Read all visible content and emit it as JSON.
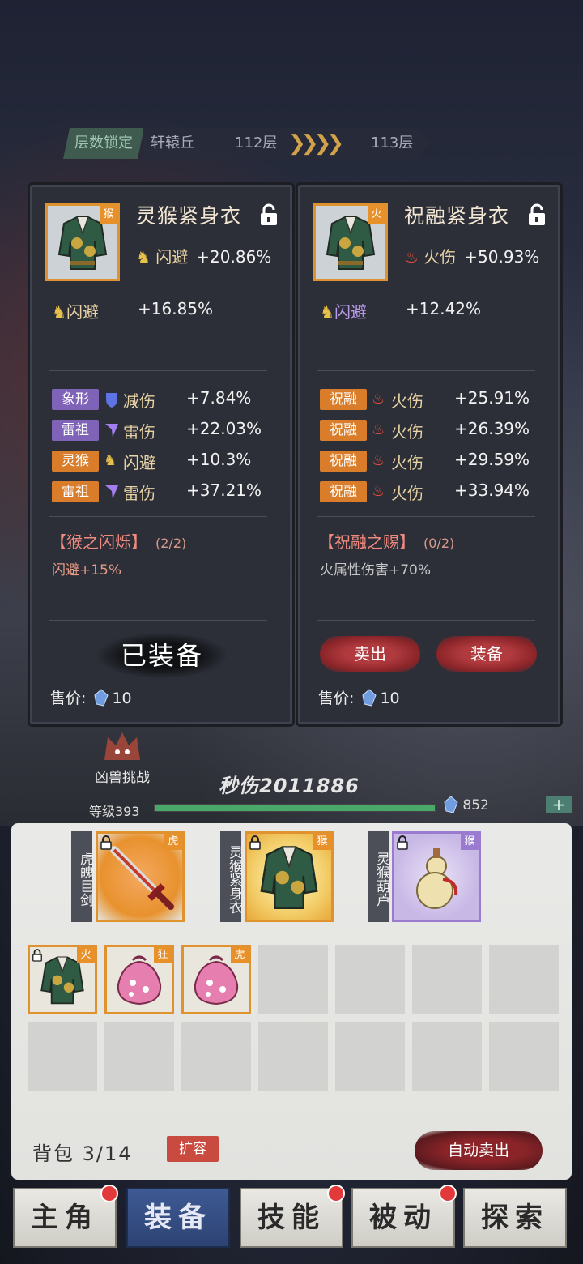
{
  "header": {
    "floor_lock": "层数锁定",
    "location": "轩辕丘",
    "floor_current": "112层",
    "floor_next": "113层"
  },
  "panel_left": {
    "tag": "猴",
    "name": "灵猴紧身衣",
    "main_attr": {
      "label": "闪避",
      "value": "+20.86%"
    },
    "sub_attr": {
      "label": "闪避",
      "value": "+16.85%"
    },
    "extra_attrs": [
      {
        "tag": "象形",
        "tag_color": "purple",
        "icon": "shield-icon",
        "label": "减伤",
        "value": "+7.84%"
      },
      {
        "tag": "雷祖",
        "tag_color": "purple",
        "icon": "thunder-icon",
        "label": "雷伤",
        "value": "+22.03%"
      },
      {
        "tag": "灵猴",
        "tag_color": "orange",
        "icon": "dodge-icon",
        "label": "闪避",
        "value": "+10.3%"
      },
      {
        "tag": "雷祖",
        "tag_color": "orange",
        "icon": "thunder-icon",
        "label": "雷伤",
        "value": "+37.21%"
      }
    ],
    "set_title": "【猴之闪烁】",
    "set_count": "(2/2)",
    "set_desc": "闪避+15%",
    "status": "已装备",
    "price_label": "售价:",
    "price_value": "10"
  },
  "panel_right": {
    "tag": "火",
    "name": "祝融紧身衣",
    "main_attr": {
      "label": "火伤",
      "value": "+50.93%"
    },
    "sub_attr": {
      "label": "闪避",
      "value": "+12.42%"
    },
    "extra_attrs": [
      {
        "tag": "祝融",
        "tag_color": "orange",
        "icon": "fire-icon",
        "label": "火伤",
        "value": "+25.91%"
      },
      {
        "tag": "祝融",
        "tag_color": "orange",
        "icon": "fire-icon",
        "label": "火伤",
        "value": "+26.39%"
      },
      {
        "tag": "祝融",
        "tag_color": "orange",
        "icon": "fire-icon",
        "label": "火伤",
        "value": "+29.59%"
      },
      {
        "tag": "祝融",
        "tag_color": "orange",
        "icon": "fire-icon",
        "label": "火伤",
        "value": "+33.94%"
      }
    ],
    "set_title": "【祝融之赐】",
    "set_count": "(0/2)",
    "set_desc": "火属性伤害+70%",
    "sell_label": "卖出",
    "equip_label": "装备",
    "price_label": "售价:",
    "price_value": "10"
  },
  "status_strip": {
    "monster_challenge": "凶兽挑战",
    "power": "秒伤2011886",
    "level": "等级393",
    "xp_progress": 1.0,
    "crystals": "852",
    "plus": "+"
  },
  "equipped_slots": [
    {
      "label": "虎魄巨剑",
      "tag": "虎",
      "icon": "sword-icon"
    },
    {
      "label": "灵猴紧身衣",
      "tag": "猴",
      "icon": "armor-icon"
    },
    {
      "label": "灵猴葫芦",
      "tag": "猴",
      "icon": "gourd-icon"
    }
  ],
  "bag_items": [
    {
      "tag": "火",
      "icon": "armor-icon"
    },
    {
      "tag": "狂",
      "icon": "pouch-icon"
    },
    {
      "tag": "虎",
      "icon": "pouch-icon"
    }
  ],
  "bag": {
    "label": "背包",
    "count": "3/14",
    "expand": "扩容",
    "auto_sell": "自动卖出"
  },
  "nav": [
    {
      "label": "主角",
      "badge": true
    },
    {
      "label": "装备",
      "badge": false,
      "active": true
    },
    {
      "label": "技能",
      "badge": true
    },
    {
      "label": "被动",
      "badge": true
    },
    {
      "label": "探索",
      "badge": false
    }
  ],
  "colors": {
    "accent_orange": "#e0922e",
    "accent_purple": "#9a7bd0",
    "nav_active": "#2d4373",
    "button_red": "#8a2428"
  }
}
